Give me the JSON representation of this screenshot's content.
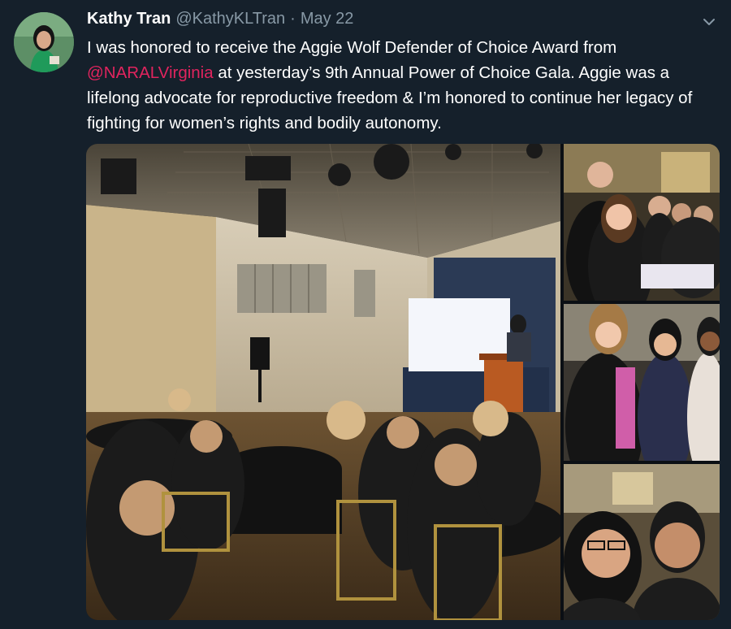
{
  "tweet": {
    "author_name": "Kathy Tran",
    "handle": "@KathyKLTran",
    "separator": "·",
    "date": "May 22",
    "text_before_mention": "I was honored to receive the Aggie Wolf Defender of Choice Award from ",
    "mention": "@NARALVirginia",
    "text_after_mention": " at yesterday’s 9th Annual Power of Choice Gala. Aggie was a lifelong advocate for reproductive freedom & I’m honored to continue her legacy of fighting for women’s rights and bodily autonomy."
  },
  "icons": {
    "menu": "chevron-down-icon"
  },
  "colors": {
    "background": "#15202b",
    "secondary_text": "#8899a6",
    "mention": "#e0245e",
    "text": "#ffffff"
  }
}
